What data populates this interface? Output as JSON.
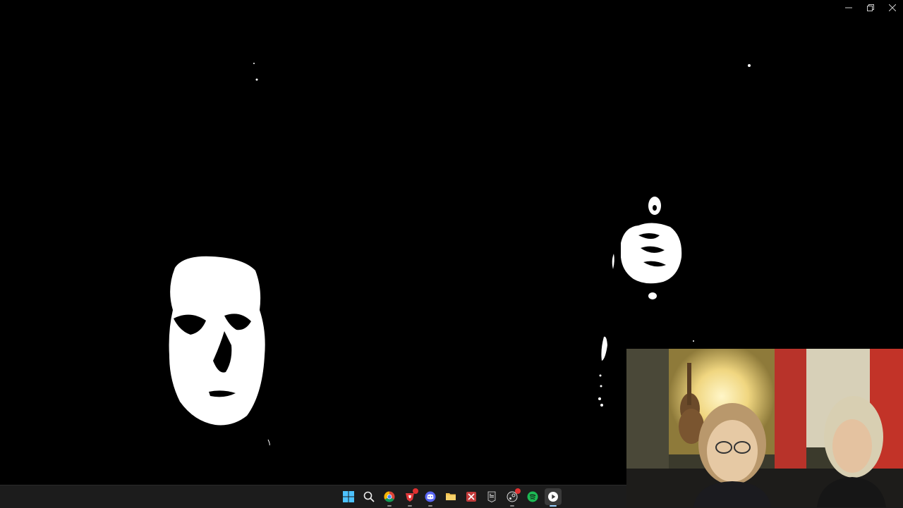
{
  "window": {
    "controls": {
      "minimize_icon": "minimize-icon",
      "restore_icon": "restore-icon",
      "close_icon": "close-icon"
    }
  },
  "scene": {
    "description_icon": "thresholded-mask-faces"
  },
  "webcam": {
    "icon": "webcam-feed"
  },
  "taskbar": {
    "icons": [
      "start-icon",
      "search-icon",
      "chrome-icon",
      "red-app-icon",
      "discord-icon",
      "file-explorer-icon",
      "app-icon",
      "epic-games-icon",
      "steam-icon",
      "spotify-icon",
      "media-player-icon"
    ],
    "colors": {
      "background": "#1c1c1c",
      "accent": "#9ad0ff",
      "spotify": "#1db954",
      "discord": "#5865f2",
      "folder": "#f2c14e"
    }
  }
}
